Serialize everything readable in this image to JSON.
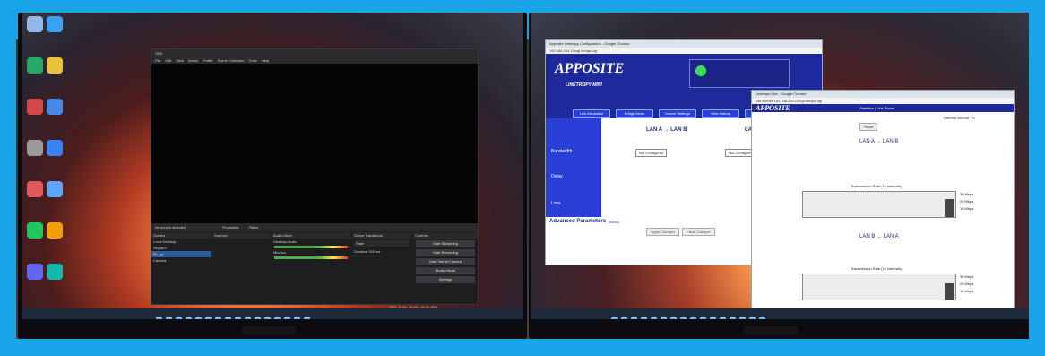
{
  "left_monitor": {
    "desktop_icons": [
      "recycle-bin",
      "app",
      "app",
      "app",
      "app",
      "app",
      "app",
      "app",
      "app",
      "app",
      "app",
      "app",
      "app",
      "app"
    ],
    "obs": {
      "menu": [
        "File",
        "Edit",
        "View",
        "Docks",
        "Profile",
        "Scene Collection",
        "Tools",
        "Help"
      ],
      "status": "No source selected",
      "props_buttons": [
        "Properties",
        "Filters"
      ],
      "scenes_header": "Scenes",
      "scenes": [
        "Local Desktop",
        "Skyfarm",
        "PL_v4",
        "Camera"
      ],
      "sources_header": "Sources",
      "mixer_header": "Audio Mixer",
      "mixer_tracks": [
        "Desktop Audio",
        "Mic/Aux"
      ],
      "transitions_header": "Scene Transitions",
      "transition_value": "Fade",
      "duration_label": "Duration",
      "duration_value": "300 ms",
      "controls_header": "Controls",
      "controls": [
        "Start Streaming",
        "Start Recording",
        "Start Virtual Camera",
        "Studio Mode",
        "Settings"
      ],
      "footer": "CPU: 0.9%, 30.00 / 30.00 FPS"
    }
  },
  "right_monitor": {
    "chrome1": {
      "title": "Apposite Linktropy Configuration - Google Chrome",
      "url": "192.168.254.10/cgi-bin/gui.cgi",
      "logo": "APPOSITE",
      "product": "LINKTROPY MINI",
      "tabs": [
        "Link Emulation",
        "Bridge Mode",
        "Device Settings",
        "View History",
        "Upgrade"
      ],
      "dir_header": "LAN A → LAN B",
      "dir_header_b": "LAN B",
      "rows": [
        "Bandwidth",
        "Delay",
        "Loss"
      ],
      "bandwidth_value": "Not Configured",
      "advanced_label": "Advanced Parameters",
      "advanced_link": "[show]",
      "buttons": [
        "Apply Changes",
        "Clear Changes"
      ]
    },
    "chrome2": {
      "title": "Linktropy Mini - Google Chrome",
      "url": "Not secure  192.168.254.10/cgi-bin/gui.cgi",
      "logo": "APPOSITE",
      "nav": "Statistics  |  Link Status",
      "refresh": "Refresh interval: 1s",
      "reset": "Reset",
      "section1": "LAN A → LAN B",
      "section2": "LAN B → LAN A",
      "graph1_title": "Transmission Rate (1s intervals)",
      "graph2_title": "Transmission Rate (1s intervals)",
      "ylabels": [
        "30 Mbps",
        "20 Mbps",
        "10 Mbps"
      ]
    }
  }
}
